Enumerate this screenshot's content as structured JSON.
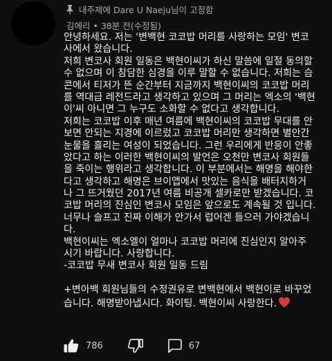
{
  "comment": {
    "pinned_text": "내주제에 Dare U Naeju님이 고정함",
    "author": "김에리",
    "meta_separator": " • ",
    "time": "38분 전(수정됨)",
    "body_lines": [
      "안녕하세요. 저는 '변백현 코코밥 머리를 사랑하는 모임' 변코",
      "사에서 왔습니다.",
      "저희 변코사 회원 일동은 백현이씨가 하신 말씀에 일절 동의할",
      "수 없으며 이 참담한 심경을 이루 말할 수 없습니다. 저희는 슴",
      "콘에서 티저가 뜬 순간부터 지금까지 백현이씨의 코코밥 머리",
      "를 역대급 레전드라고 생각하고 있으며 그 머리는 엑소의 '백현",
      "이'씨 아니면 그 누구도 소화할 수 없다고 생각합니다.",
      "저희는 코코밥 이후 매년 여름에 백현이씨의 코코밥 무대를 안",
      "보면 안되는 지경에 이르렀고 코코밥 머리만 생각하면 별안간",
      "눈물을 흘리는 여성이 되었습니다. 그런 우리에게 반응이 안좋",
      "았다고 하는 이러한 백현이씨의 발언은 오천만 변코사 회원들",
      "을 죽이는 행위라고 생각합니다. 이 부분에서는 해명을 해야한",
      "다고 생각하고 해명은 브이앱에서 맛있는 음식을 배터지하거",
      "나 그 뜨거웠던 2017년 여름 비공개 셀카로만 받겠습니다. 코",
      "코밥 머리의 진심인 변코사 모임은 앞으로도 계속될 것 입니다.",
      "너무나 슬프고 진짜 이해가 안가서 럽어겐 들으러 가야겠습니",
      "다.",
      "백현이씨는 엑소엘이 얼마나 코코밥 머리에 진심인지 알아주",
      "시기 바랍니다. 사랑합니다.",
      "-코코밥 무새 변코사 회원 일동 드림"
    ],
    "ps_lines": [
      "+변아백 회원님들의 수정권유로 변백현에서 백현이로 바꾸었",
      "습니다. 해명받아냅시다. 화이팅. 백현이씨 사랑한다."
    ],
    "heart_color": "#d63b3b",
    "like_count": "786",
    "reply_count": "67"
  },
  "icons": {
    "pin": "pin-icon",
    "like": "thumbs-up-icon",
    "dislike": "thumbs-down-icon",
    "reply": "reply-icon",
    "heart": "heart-icon"
  }
}
